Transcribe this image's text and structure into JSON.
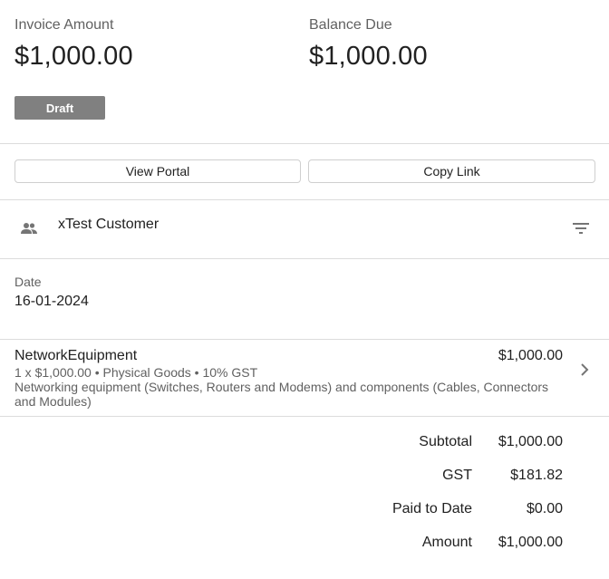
{
  "summary": {
    "invoice_amount_label": "Invoice Amount",
    "invoice_amount_value": "$1,000.00",
    "balance_due_label": "Balance Due",
    "balance_due_value": "$1,000.00",
    "status_badge": "Draft",
    "status_color": "#808080"
  },
  "actions": {
    "view_portal": "View Portal",
    "copy_link": "Copy Link"
  },
  "customer": {
    "name": "xTest Customer",
    "icon": "people-icon",
    "filter_icon": "filter-icon"
  },
  "details": {
    "date_label": "Date",
    "date_value": "16-01-2024"
  },
  "line_item": {
    "name": "NetworkEquipment",
    "amount": "$1,000.00",
    "meta": "1 x $1,000.00 • Physical Goods • 10% GST",
    "description": "Networking equipment (Switches, Routers and Modems) and components (Cables, Connectors and Modules)"
  },
  "totals": [
    {
      "label": "Subtotal",
      "value": "$1,000.00"
    },
    {
      "label": "GST",
      "value": "$181.82"
    },
    {
      "label": "Paid to Date",
      "value": "$0.00"
    },
    {
      "label": "Amount",
      "value": "$1,000.00"
    }
  ]
}
